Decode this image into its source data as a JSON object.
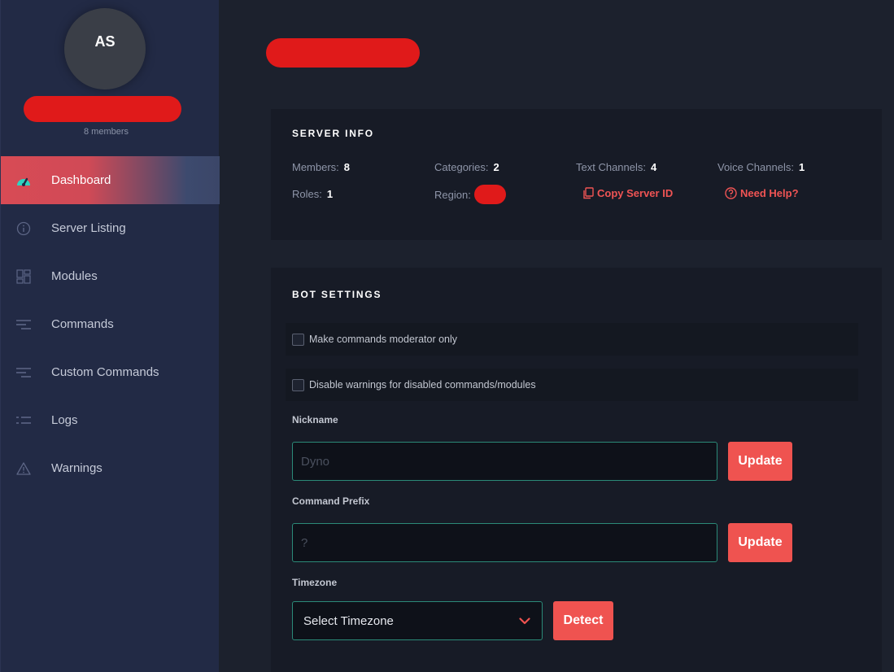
{
  "sidebar": {
    "avatar_initials": "AS",
    "members_count": "8 members",
    "items": [
      {
        "label": "Dashboard",
        "icon": "dashboard-gauge-icon"
      },
      {
        "label": "Server Listing",
        "icon": "info-circle-icon"
      },
      {
        "label": "Modules",
        "icon": "modules-grid-icon"
      },
      {
        "label": "Commands",
        "icon": "commands-lines-icon"
      },
      {
        "label": "Custom Commands",
        "icon": "custom-commands-lines-icon"
      },
      {
        "label": "Logs",
        "icon": "logs-list-icon"
      },
      {
        "label": "Warnings",
        "icon": "warning-triangle-icon"
      }
    ],
    "active_item": "Dashboard"
  },
  "server_info": {
    "title": "SERVER INFO",
    "members_label": "Members:",
    "members_value": "8",
    "categories_label": "Categories:",
    "categories_value": "2",
    "text_channels_label": "Text Channels:",
    "text_channels_value": "4",
    "voice_channels_label": "Voice Channels:",
    "voice_channels_value": "1",
    "roles_label": "Roles:",
    "roles_value": "1",
    "region_label": "Region:",
    "copy_server_id": "Copy Server ID",
    "need_help": "Need Help?"
  },
  "bot_settings": {
    "title": "BOT SETTINGS",
    "moderator_only_label": "Make commands moderator only",
    "disable_warnings_label": "Disable warnings for disabled commands/modules",
    "nickname_label": "Nickname",
    "nickname_placeholder": "Dyno",
    "update_label": "Update",
    "prefix_label": "Command Prefix",
    "prefix_placeholder": "?",
    "timezone_label": "Timezone",
    "timezone_value": "Select Timezone",
    "detect_label": "Detect"
  },
  "colors": {
    "accent_red": "#ef5350",
    "input_border": "#2b8a78",
    "sidebar_bg": "#222a45",
    "page_bg": "#1c212d",
    "card_bg": "#171b26",
    "redaction": "#e01a1a"
  }
}
